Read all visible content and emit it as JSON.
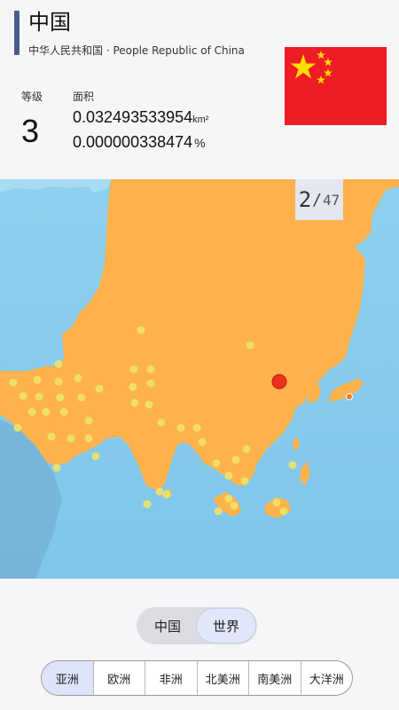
{
  "country": {
    "name": "中国",
    "full_name": "中华人民共和国 · People Republic of China",
    "flag_colors": {
      "red": "#ee1c25",
      "yellow": "#ffde00"
    }
  },
  "stats": {
    "rank_label": "等级",
    "rank_value": "3",
    "area_label": "面积",
    "area_km2": "0.032493533954",
    "area_unit": "km²",
    "area_percent": "0.000000338474",
    "percent_unit": "%"
  },
  "pager": {
    "current": "2",
    "separator": "/",
    "total": "47"
  },
  "map_colors": {
    "ocean": "#8fd0ef",
    "land": "#fdb24c",
    "marker": "#f0e26a",
    "pin": "#e8321e"
  },
  "toggle": {
    "options": [
      "中国",
      "世界"
    ],
    "active_index": 1
  },
  "continents": {
    "tabs": [
      "亚洲",
      "欧洲",
      "非洲",
      "北美洲",
      "南美洲",
      "大洋洲"
    ],
    "active_index": 0
  }
}
